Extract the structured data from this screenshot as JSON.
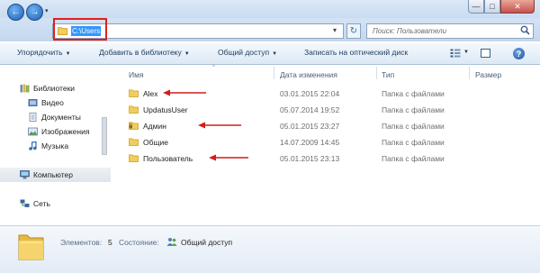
{
  "window": {
    "minimize_glyph": "—",
    "maximize_glyph": "□",
    "close_glyph": "✕"
  },
  "nav": {
    "back_glyph": "←",
    "forward_glyph": "→",
    "history_glyph": "▾"
  },
  "address": {
    "path": "C:\\Users",
    "dropdown_glyph": "▾",
    "refresh_glyph": "↻"
  },
  "search": {
    "placeholder": "Поиск: Пользователи"
  },
  "toolbar": {
    "organize": "Упорядочить",
    "add_to_library": "Добавить в библиотеку",
    "share": "Общий доступ",
    "burn": "Записать на оптический диск",
    "caret": "▼",
    "help": "?"
  },
  "sidebar": {
    "libraries": "Библиотеки",
    "video": "Видео",
    "documents": "Документы",
    "images": "Изображения",
    "music": "Музыка",
    "computer": "Компьютер",
    "network": "Сеть"
  },
  "columns": {
    "name": "Имя",
    "date": "Дата изменения",
    "type": "Тип",
    "size": "Размер",
    "sort_glyph": "^"
  },
  "files": [
    {
      "name": "Alex",
      "date": "03.01.2015 22:04",
      "type": "Папка с файлами",
      "icon": "folder-icon",
      "locked": false,
      "arrow": true
    },
    {
      "name": "UpdatusUser",
      "date": "05.07.2014 19:52",
      "type": "Папка с файлами",
      "icon": "folder-icon",
      "locked": false,
      "arrow": false
    },
    {
      "name": "Админ",
      "date": "05.01.2015 23:27",
      "type": "Папка с файлами",
      "icon": "locked-folder-icon",
      "locked": true,
      "arrow": true
    },
    {
      "name": "Общие",
      "date": "14.07.2009 14:45",
      "type": "Папка с файлами",
      "icon": "folder-icon",
      "locked": false,
      "arrow": false
    },
    {
      "name": "Пользователь",
      "date": "05.01.2015 23:13",
      "type": "Папка с файлами",
      "icon": "folder-icon",
      "locked": false,
      "arrow": true
    }
  ],
  "details": {
    "count_label": "Элементов:",
    "count_value": "5",
    "state_label": "Состояние:",
    "state_value": "Общий доступ"
  },
  "colors": {
    "highlight_red": "#e0201f",
    "address_selection": "#3297fd",
    "folder_yellow": "#f3cd5b",
    "annotation_arrow": "#d41c1c"
  }
}
